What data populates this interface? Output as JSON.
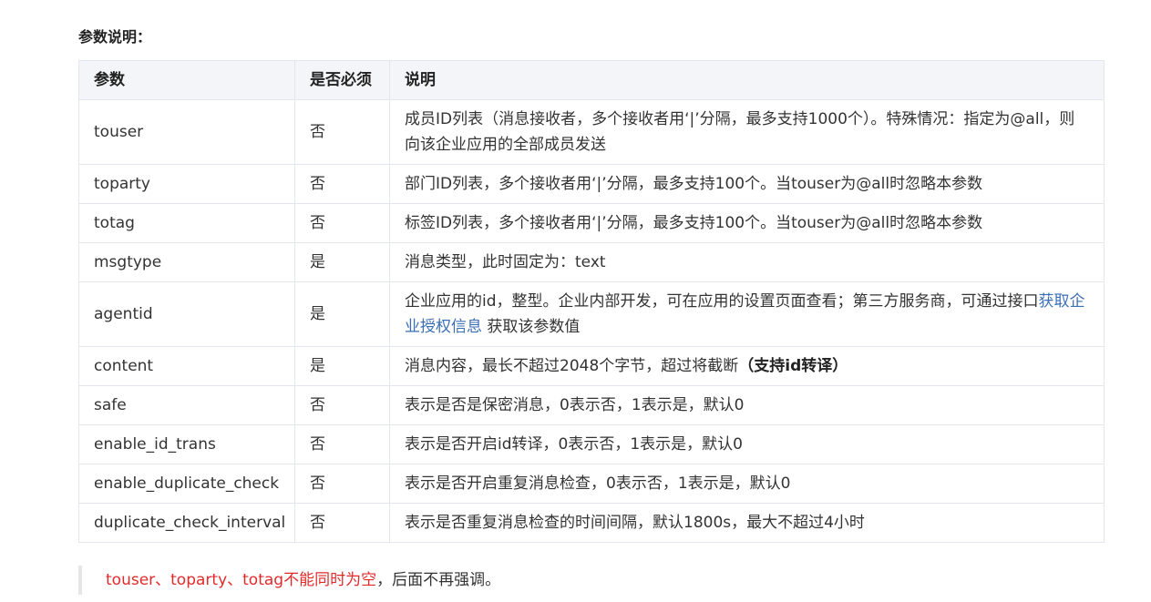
{
  "section_title": "参数说明：",
  "table": {
    "headers": [
      "参数",
      "是否必须",
      "说明"
    ],
    "rows": [
      {
        "param": "touser",
        "required": "否",
        "desc": "成员ID列表（消息接收者，多个接收者用‘|’分隔，最多支持1000个）。特殊情况：指定为@all，则向该企业应用的全部成员发送"
      },
      {
        "param": "toparty",
        "required": "否",
        "desc": "部门ID列表，多个接收者用‘|’分隔，最多支持100个。当touser为@all时忽略本参数"
      },
      {
        "param": "totag",
        "required": "否",
        "desc": "标签ID列表，多个接收者用‘|’分隔，最多支持100个。当touser为@all时忽略本参数"
      },
      {
        "param": "msgtype",
        "required": "是",
        "desc": "消息类型，此时固定为：text"
      },
      {
        "param": "agentid",
        "required": "是",
        "desc_pre": "企业应用的id，整型。企业内部开发，可在应用的设置页面查看；第三方服务商，可通过接口",
        "desc_link": "获取企业授权信息",
        "desc_post": " 获取该参数值"
      },
      {
        "param": "content",
        "required": "是",
        "desc_pre": "消息内容，最长不超过2048个字节，超过将截断",
        "desc_bold": "（支持id转译）"
      },
      {
        "param": "safe",
        "required": "否",
        "desc": "表示是否是保密消息，0表示否，1表示是，默认0"
      },
      {
        "param": "enable_id_trans",
        "required": "否",
        "desc": "表示是否开启id转译，0表示否，1表示是，默认0"
      },
      {
        "param": "enable_duplicate_check",
        "required": "否",
        "desc": "表示是否开启重复消息检查，0表示否，1表示是，默认0"
      },
      {
        "param": "duplicate_check_interval",
        "required": "否",
        "desc": "表示是否重复消息检查的时间间隔，默认1800s，最大不超过4小时"
      }
    ]
  },
  "note": {
    "red_text": "touser、toparty、totag不能同时为空",
    "rest_text": "，后面不再强调。"
  }
}
